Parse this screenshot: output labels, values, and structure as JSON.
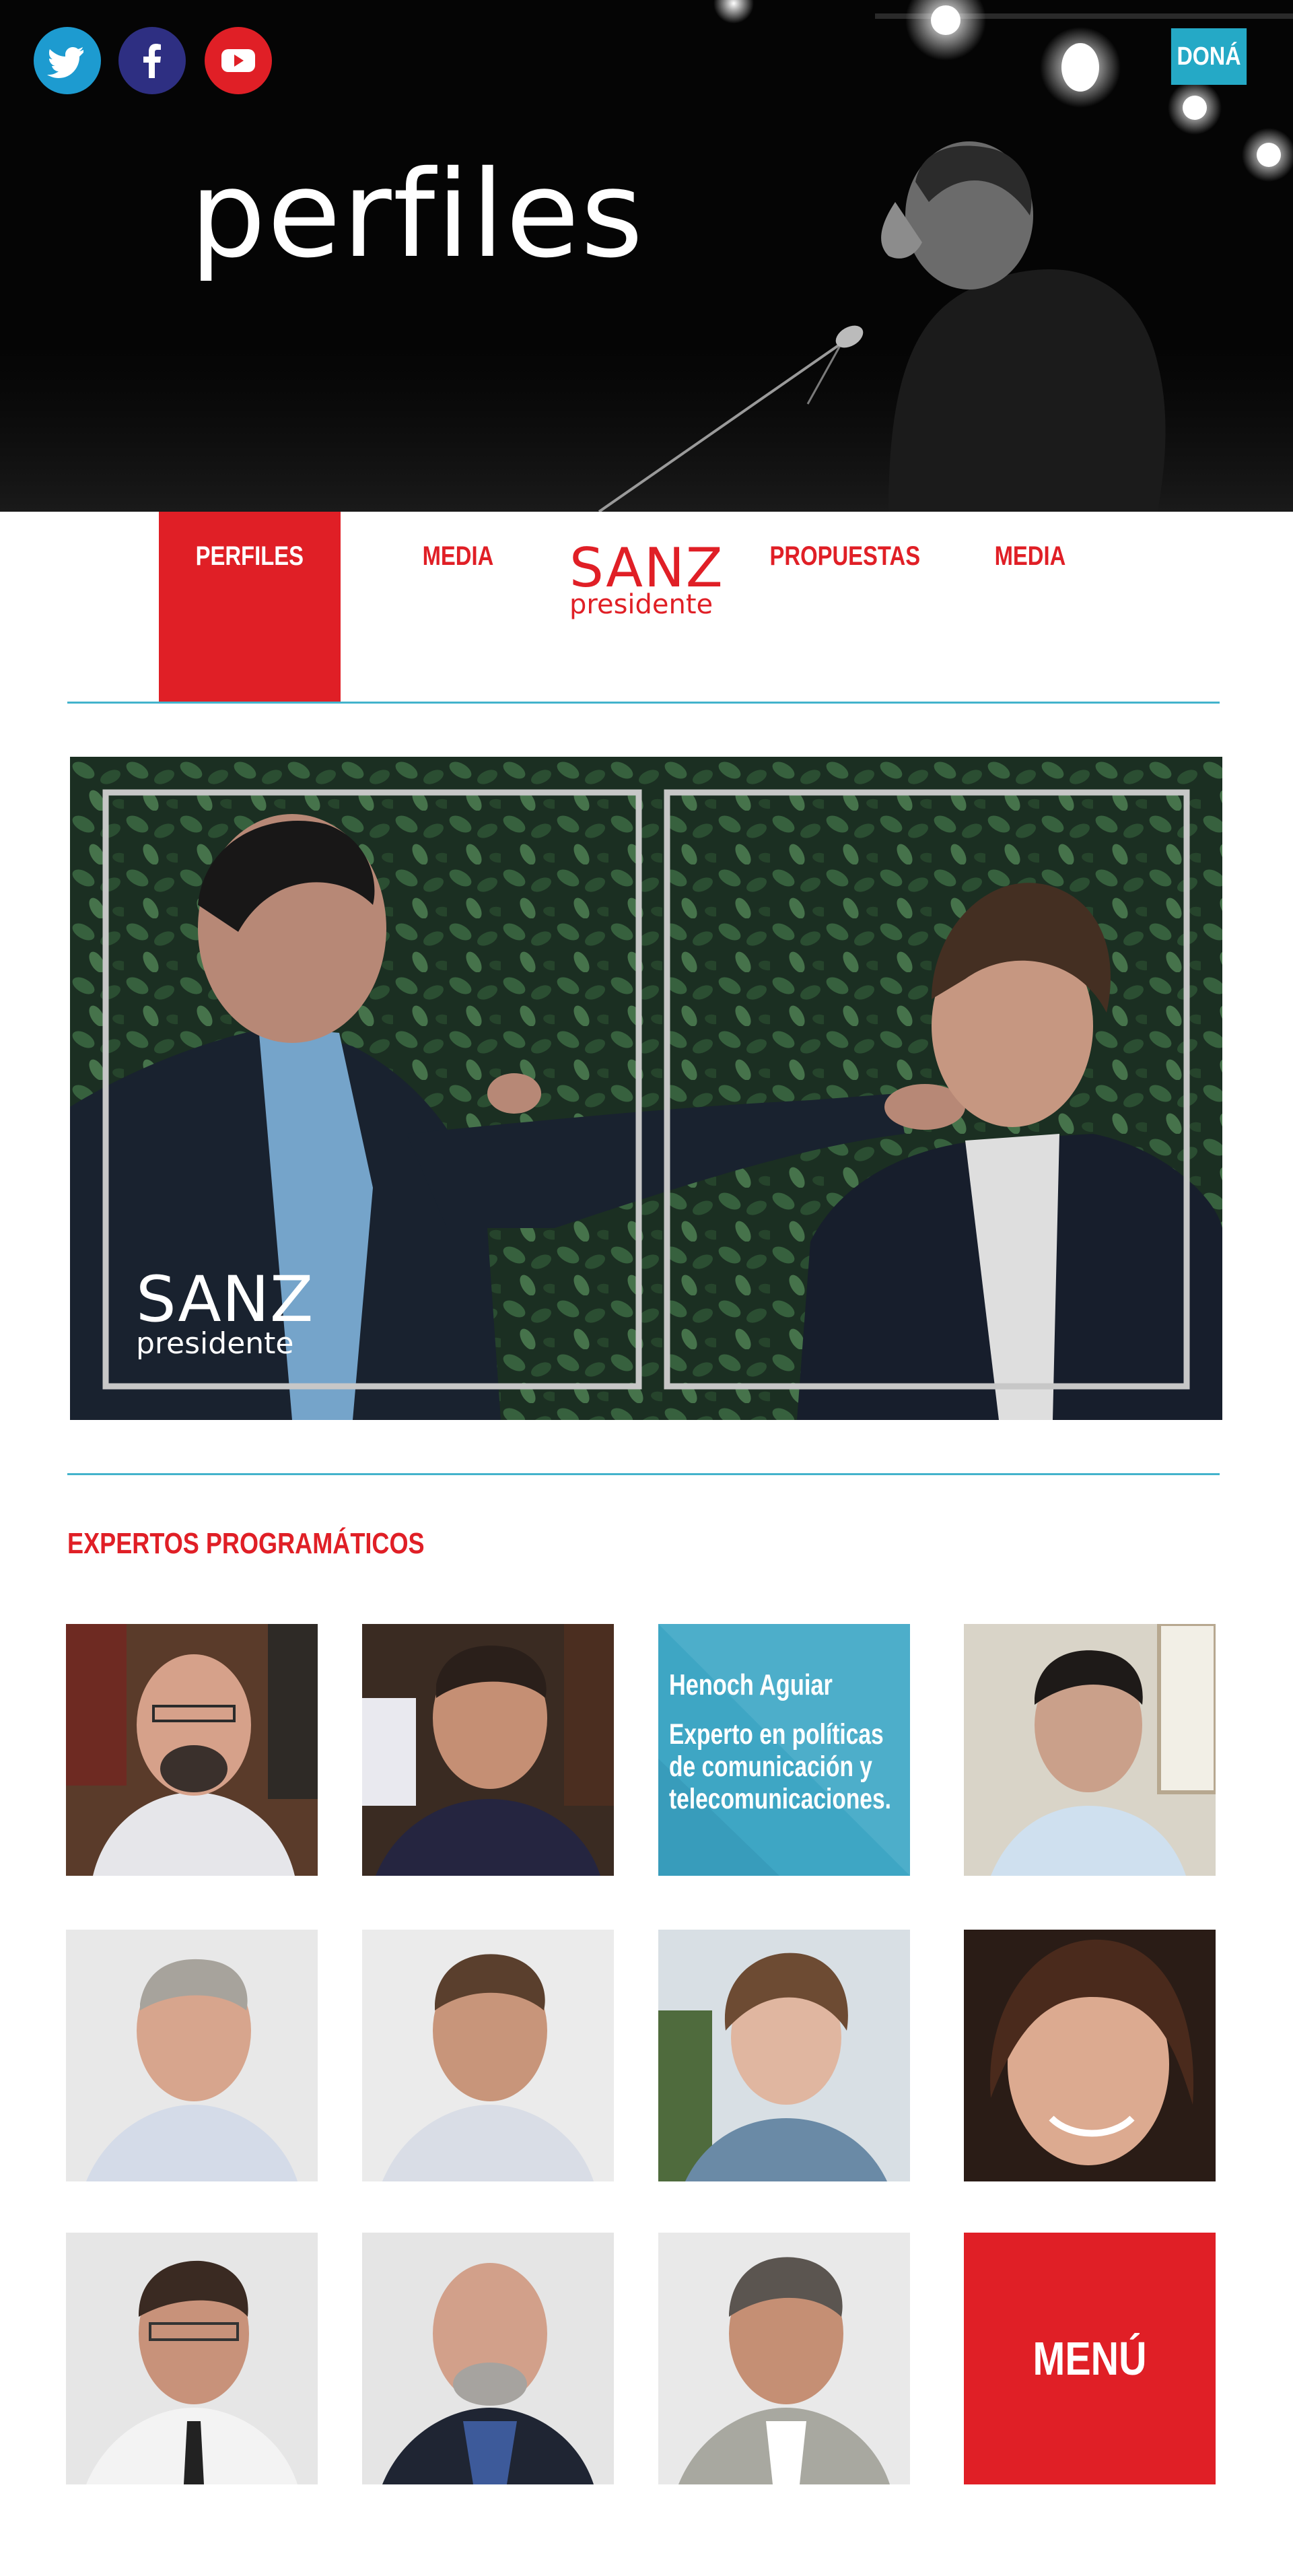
{
  "social": [
    {
      "name": "twitter",
      "icon": "twitter-icon",
      "color": "#1d9bd0"
    },
    {
      "name": "facebook",
      "icon": "facebook-icon",
      "color": "#2e2f82"
    },
    {
      "name": "youtube",
      "icon": "youtube-icon",
      "color": "#e01f26"
    }
  ],
  "hero": {
    "title": "perfiles",
    "donate_label": "DONÁ"
  },
  "nav": {
    "items": [
      "PERFILES",
      "MEDIA",
      "PROPUESTAS",
      "MEDIA"
    ],
    "active": "PERFILES",
    "logo_line1": "SANZ",
    "logo_line2": "presidente"
  },
  "banner": {
    "logo_line1": "SANZ",
    "logo_line2": "presidente"
  },
  "experts": {
    "title": "EXPERTOS PROGRAMÁTICOS",
    "featured": {
      "name": "Henoch Aguiar",
      "description": "Experto en políticas de comunicación y telecomunicaciones."
    },
    "menu_label": "MENÚ"
  },
  "colors": {
    "brand_red": "#e01f26",
    "accent_blue": "#25a9c6",
    "rule_blue": "#43b3cc"
  }
}
